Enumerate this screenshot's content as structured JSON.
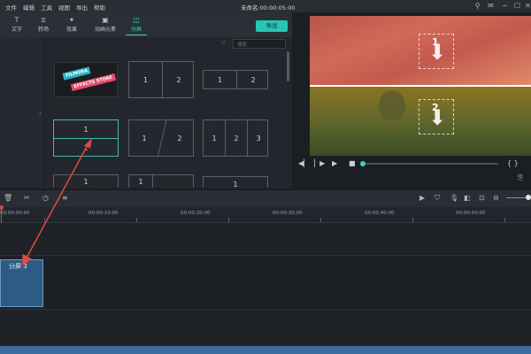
{
  "menu": {
    "items": [
      "文件",
      "编辑",
      "工具",
      "视图",
      "导出",
      "帮助"
    ],
    "title": "未命名:",
    "timecode": "00:00:05:00"
  },
  "tabs": [
    {
      "label": "文字",
      "icon": "text-icon"
    },
    {
      "label": "转场",
      "icon": "transition-icon"
    },
    {
      "label": "效果",
      "icon": "effects-icon"
    },
    {
      "label": "动画元素",
      "icon": "elements-icon"
    },
    {
      "label": "分屏",
      "icon": "splitscreen-icon",
      "active": true
    }
  ],
  "export_label": "导出",
  "search_placeholder": "搜索",
  "library": {
    "filmora_badge_1": "FILMORA",
    "filmora_badge_2": "EFFECTS STORE",
    "tiles": {
      "t2": [
        "1",
        "2"
      ],
      "t3": [
        "1",
        "2"
      ],
      "t4": [
        "1",
        "2"
      ],
      "t5": [
        "1",
        "2"
      ],
      "t6": [
        "1",
        "2",
        "3"
      ],
      "t7": [
        "1"
      ],
      "t8": [
        "1"
      ],
      "t9": [
        "1"
      ]
    }
  },
  "preview": {
    "slot1": "1",
    "slot2": "2"
  },
  "ruler_ticks": [
    "00:00:00:00",
    "00:00:10:00",
    "00:00:20:00",
    "00:00:30:00",
    "00:00:40:00",
    "00:00:50:00"
  ],
  "clip_label": "分屏 3",
  "colors": {
    "accent": "#27c6b6",
    "playhead": "#e2433c",
    "clip": "#2e5b83",
    "annotation_arrow": "#e04a3f"
  }
}
